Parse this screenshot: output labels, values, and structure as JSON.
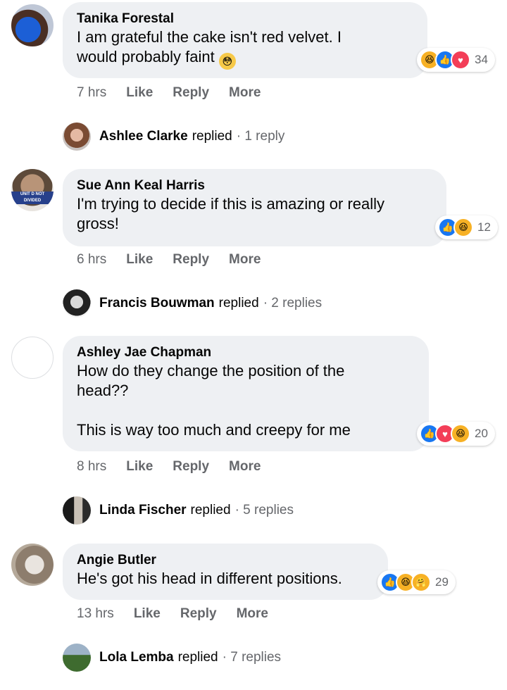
{
  "comments": [
    {
      "author": "Tanika Forestal",
      "text": "I am grateful the cake isn't red velvet. I\nwould probably faint",
      "emoji": "😳",
      "time": "7 hrs",
      "like": "Like",
      "reply": "Reply",
      "more": "More",
      "reaction_count": "34",
      "reactions": [
        "haha",
        "like",
        "love"
      ],
      "replier": "Ashlee Clarke",
      "replied_word": "replied",
      "reply_count": "· 1 reply"
    },
    {
      "author": "Sue Ann Keal Harris",
      "text": "I'm trying to decide if this is amazing or really\ngross!",
      "time": "6 hrs",
      "like": "Like",
      "reply": "Reply",
      "more": "More",
      "reaction_count": "12",
      "reactions": [
        "like",
        "haha"
      ],
      "replier": "Francis Bouwman",
      "replied_word": "replied",
      "reply_count": "· 2 replies",
      "avatar_text": "UNIT D NOT DIVIDED"
    },
    {
      "author": "Ashley Jae Chapman",
      "text": "How do they change the position of the\nhead??\n\nThis is way too much and creepy for me",
      "time": "8 hrs",
      "like": "Like",
      "reply": "Reply",
      "more": "More",
      "reaction_count": "20",
      "reactions": [
        "like",
        "love",
        "haha"
      ],
      "replier": "Linda Fischer",
      "replied_word": "replied",
      "reply_count": "· 5 replies"
    },
    {
      "author": "Angie Butler",
      "text": "He's got his head in different positions.",
      "time": "13 hrs",
      "like": "Like",
      "reply": "Reply",
      "more": "More",
      "reaction_count": "29",
      "reactions": [
        "like",
        "haha",
        "care"
      ],
      "replier": "Lola Lemba",
      "replied_word": "replied",
      "reply_count": "· 7 replies"
    }
  ],
  "icons": {
    "like": "thumbs-up-icon",
    "love": "heart-icon",
    "haha": "laughing-face-icon",
    "care": "care-face-icon"
  },
  "colors": {
    "bubble": "#eef0f3",
    "meta": "#65676b",
    "like": "#1877f2",
    "love": "#f33e58",
    "haha": "#f7b125"
  }
}
